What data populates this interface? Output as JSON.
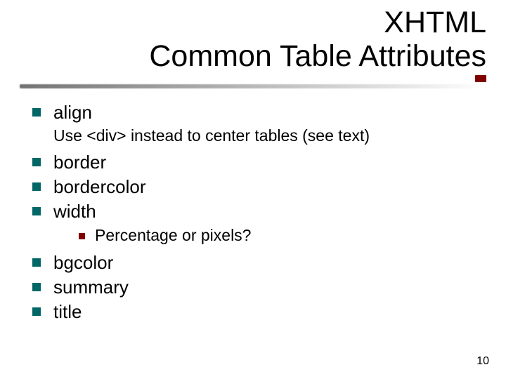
{
  "title_line1": "XHTML",
  "title_line2": "Common Table Attributes",
  "items": {
    "align": "align",
    "align_note": "Use <div> instead to center tables (see text)",
    "border": "border",
    "bordercolor": "bordercolor",
    "width": "width",
    "width_sub": "Percentage or pixels?",
    "bgcolor": "bgcolor",
    "summary": "summary",
    "title_attr": "title"
  },
  "page_number": "10"
}
